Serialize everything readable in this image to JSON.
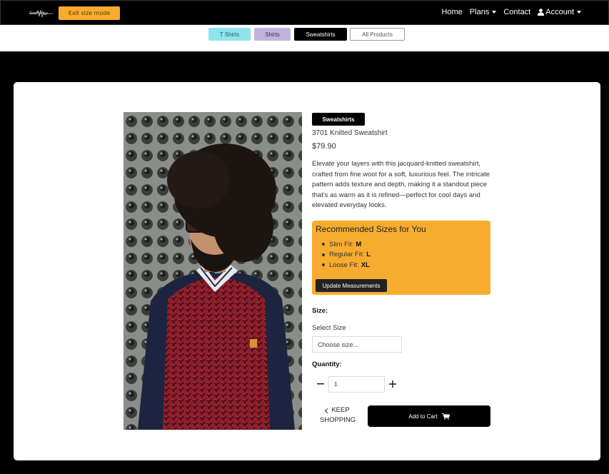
{
  "navbar": {
    "logo_text": "SizeMeApp",
    "exit_label": "Exit size mode",
    "links": [
      "Home",
      "Plans",
      "Contact",
      "Account"
    ]
  },
  "categories": [
    "T Shirts",
    "Shirts",
    "Sweatshirts",
    "All Products"
  ],
  "product": {
    "badge": "Sweatshirts",
    "name": "3701 Knitted Sweatshirt",
    "price": "$79.90",
    "description": "Elevate your layers with this jacquard-knitted sweatshirt, crafted from fine wool for a soft, luxurious feel. The intricate pattern adds texture and depth, making it a standout piece that's as warm as it is refined—perfect for cool days and elevated everyday looks."
  },
  "recommendation": {
    "title": "Recommended Sizes for You",
    "items": [
      {
        "fit": "Slim Fit:",
        "size": "M"
      },
      {
        "fit": "Regular Fit:",
        "size": "L"
      },
      {
        "fit": "Loose Fit:",
        "size": "XL"
      }
    ],
    "button": "Update Measurements"
  },
  "form": {
    "size_label": "Size:",
    "select_label": "Select Size",
    "select_placeholder": "Choose size...",
    "quantity_label": "Quantity:",
    "quantity_value": "1"
  },
  "actions": {
    "keep_top": "KEEP",
    "keep_bottom": "SHOPPING",
    "add_to_cart": "Add to Cart"
  },
  "colors": {
    "accent": "#f7ac2f",
    "tshirts_pill": "#8ee3ee",
    "shirts_pill": "#c2b3de",
    "dark": "#000000"
  }
}
